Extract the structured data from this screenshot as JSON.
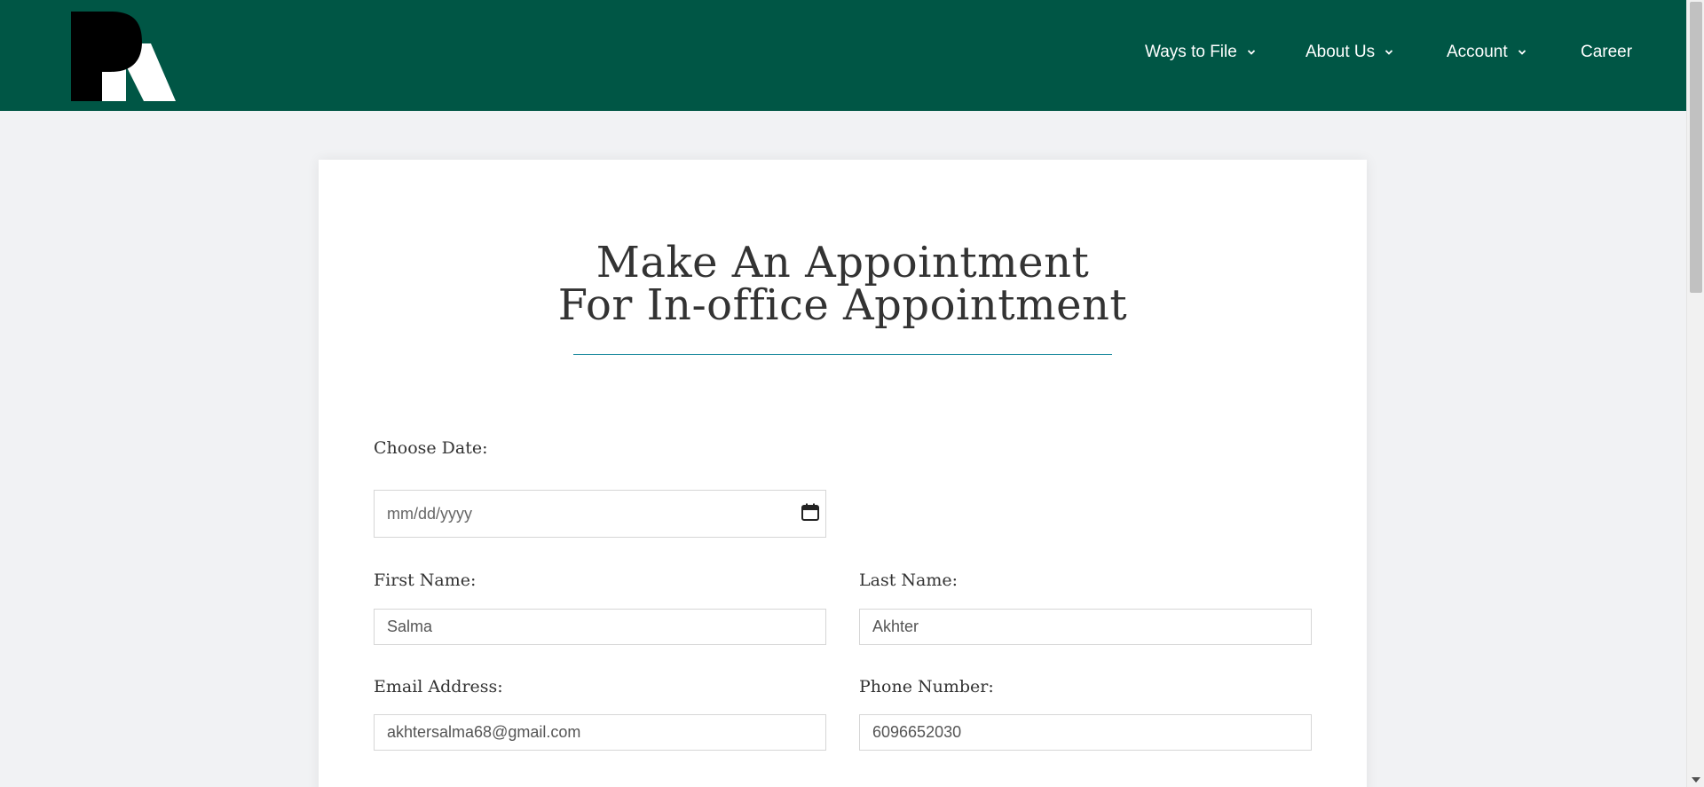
{
  "nav": {
    "items": [
      {
        "label": "Ways to File",
        "has_dropdown": true
      },
      {
        "label": "About Us",
        "has_dropdown": true
      },
      {
        "label": "Account",
        "has_dropdown": true
      },
      {
        "label": "Career",
        "has_dropdown": false
      }
    ]
  },
  "page": {
    "title_line1": "Make An Appointment",
    "title_line2": "For In-office Appointment"
  },
  "form": {
    "date_label": "Choose Date:",
    "date_placeholder": "mm/dd/yyyy",
    "first_name_label": "First Name:",
    "first_name_value": "Salma",
    "last_name_label": "Last Name:",
    "last_name_value": "Akhter",
    "email_label": "Email Address:",
    "email_value": "akhtersalma68@gmail.com",
    "phone_label": "Phone Number:",
    "phone_value": "6096652030"
  },
  "colors": {
    "header_bg": "#005645",
    "accent_underline": "#1b8a9e",
    "page_bg": "#f1f2f4"
  },
  "icons": {
    "logo": "pr-logo",
    "chevron": "chevron-down-icon",
    "calendar": "calendar-icon"
  }
}
